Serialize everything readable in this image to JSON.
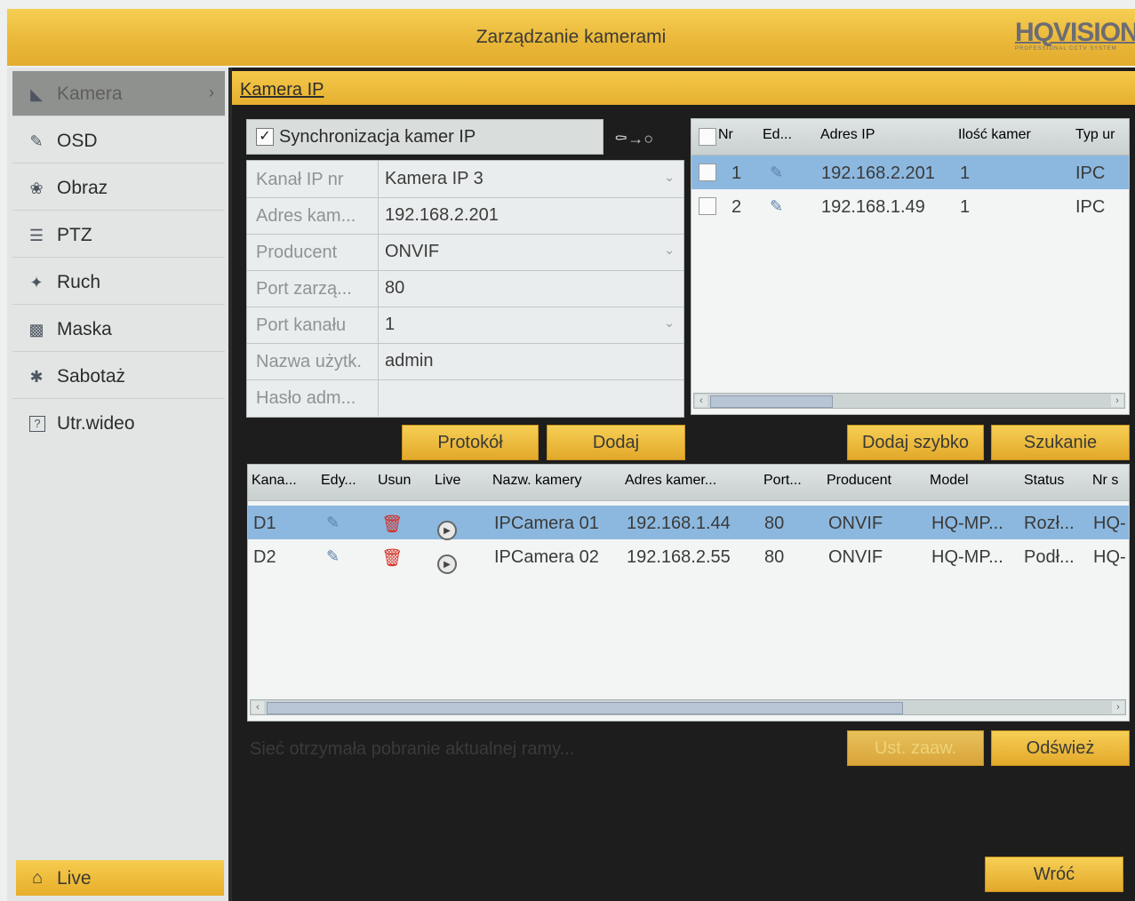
{
  "window": {
    "title": "Zarządzanie kamerami",
    "logo": "HQVISION",
    "logo_sub": "PROFESSIONAL CCTV SYSTEM"
  },
  "sidebar": {
    "items": [
      {
        "label": "Kamera",
        "icon": "camera-icon"
      },
      {
        "label": "OSD",
        "icon": "osd-icon"
      },
      {
        "label": "Obraz",
        "icon": "image-icon"
      },
      {
        "label": "PTZ",
        "icon": "ptz-icon"
      },
      {
        "label": "Ruch",
        "icon": "motion-icon"
      },
      {
        "label": "Maska",
        "icon": "mask-icon"
      },
      {
        "label": "Sabotaż",
        "icon": "tamper-icon"
      },
      {
        "label": "Utr.wideo",
        "icon": "video-loss-icon"
      }
    ],
    "live_label": "Live"
  },
  "tab": {
    "label": "Kamera IP"
  },
  "sync": {
    "label": "Synchronizacja kamer IP",
    "checked": true
  },
  "form": {
    "rows": [
      {
        "label": "Kanał IP nr",
        "value": "Kamera IP 3",
        "dropdown": true
      },
      {
        "label": "Adres kam...",
        "value": "192.168.2.201",
        "dropdown": false
      },
      {
        "label": "Producent",
        "value": "ONVIF",
        "dropdown": true
      },
      {
        "label": "Port zarzą...",
        "value": "80",
        "dropdown": false
      },
      {
        "label": "Port kanału",
        "value": "1",
        "dropdown": true
      },
      {
        "label": "Nazwa użytk.",
        "value": "admin",
        "dropdown": false
      },
      {
        "label": "Hasło adm...",
        "value": "",
        "dropdown": false
      }
    ]
  },
  "iplist": {
    "headers": [
      "Nr",
      "Ed...",
      "Adres IP",
      "Ilość kamer",
      "Typ ur"
    ],
    "rows": [
      {
        "nr": "1",
        "ip": "192.168.2.201",
        "count": "1",
        "type": "IPC",
        "selected": true
      },
      {
        "nr": "2",
        "ip": "192.168.1.49",
        "count": "1",
        "type": "IPC",
        "selected": false
      }
    ]
  },
  "buttons": {
    "protocol": "Protokół",
    "add": "Dodaj",
    "quick_add": "Dodaj szybko",
    "search": "Szukanie",
    "advanced": "Ust. zaaw.",
    "refresh": "Odśwież",
    "back": "Wróć"
  },
  "camlist": {
    "headers": [
      "Kana...",
      "Edy...",
      "Usun",
      "Live",
      "Nazw. kamery",
      "Adres kamer...",
      "Port...",
      "Producent",
      "Model",
      "Status",
      "Nr s"
    ],
    "rows": [
      {
        "channel": "D1",
        "name": "IPCamera 01",
        "address": "192.168.1.44",
        "port": "80",
        "producer": "ONVIF",
        "model": "HQ-MP...",
        "status": "Rozł...",
        "serial": "HQ-",
        "selected": true
      },
      {
        "channel": "D2",
        "name": "IPCamera 02",
        "address": "192.168.2.55",
        "port": "80",
        "producer": "ONVIF",
        "model": "HQ-MP...",
        "status": "Podł...",
        "serial": "HQ-",
        "selected": false
      }
    ]
  },
  "note": "Sieć otrzymała pobranie aktualnej ramy..."
}
